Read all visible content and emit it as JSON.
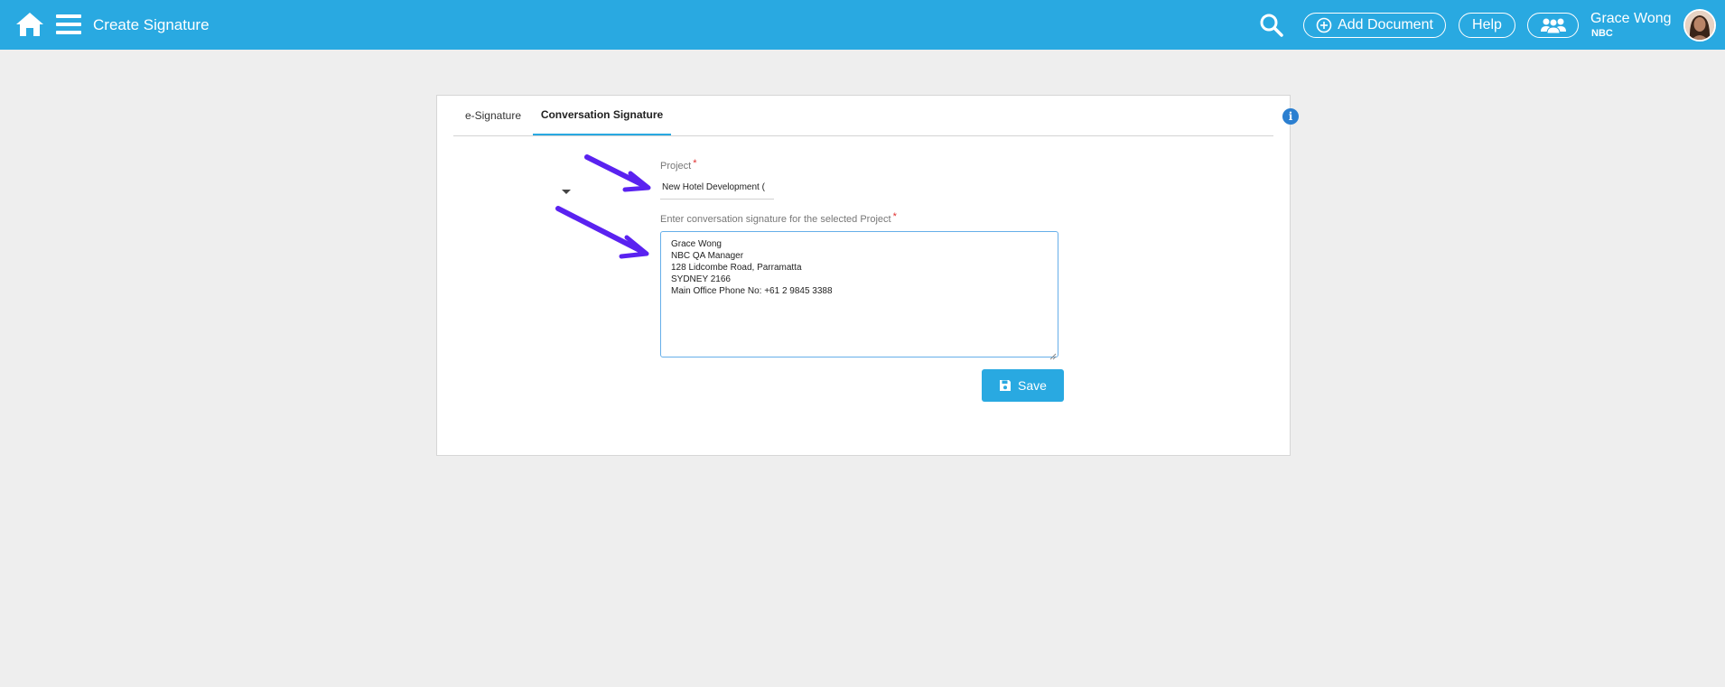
{
  "header": {
    "title": "Create Signature",
    "add_document_label": "Add Document",
    "help_label": "Help",
    "user_name": "Grace Wong",
    "user_org": "NBC",
    "accent": "#29a9e1"
  },
  "tabs": [
    {
      "label": "e-Signature",
      "active": false
    },
    {
      "label": "Conversation Signature",
      "active": true
    }
  ],
  "form": {
    "project_label": "Project",
    "required_mark": "*",
    "project_value": "New Hotel Development (",
    "signature_label": "Enter conversation signature for the selected Project",
    "signature_value": "Grace Wong\nNBC QA Manager\n128 Lidcombe Road, Parramatta\nSYDNEY 2166\nMain Office Phone No: +61 2 9845 3388",
    "save_label": "Save"
  },
  "annotations": {
    "arrow_color": "#5a22f0"
  }
}
